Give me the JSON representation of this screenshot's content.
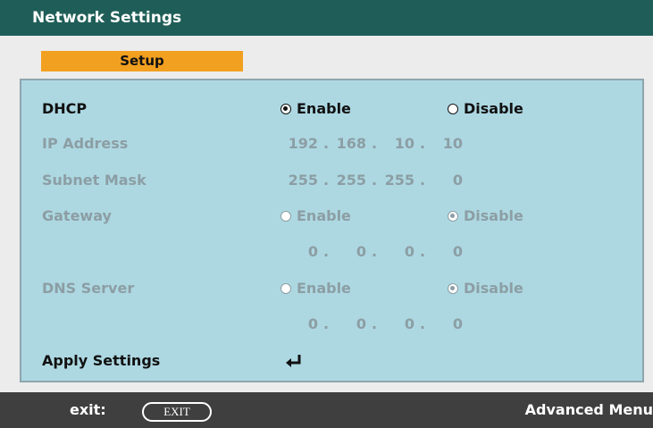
{
  "window": {
    "title": "Network Settings"
  },
  "tab": {
    "label": "Setup"
  },
  "rows": {
    "dhcp": {
      "label": "DHCP",
      "enable": "Enable",
      "disable": "Disable",
      "selected": "Enable"
    },
    "ip": {
      "label": "IP Address",
      "o1": "192",
      "o2": "168",
      "o3": "10",
      "o4": "10"
    },
    "subnet": {
      "label": "Subnet Mask",
      "o1": "255",
      "o2": "255",
      "o3": "255",
      "o4": "0"
    },
    "gateway": {
      "label": "Gateway",
      "enable": "Enable",
      "disable": "Disable",
      "selected": "Disable"
    },
    "gateway_ip": {
      "o1": "0",
      "o2": "0",
      "o3": "0",
      "o4": "0"
    },
    "dns": {
      "label": "DNS Server",
      "enable": "Enable",
      "disable": "Disable",
      "selected": "Disable"
    },
    "dns_ip": {
      "o1": "0",
      "o2": "0",
      "o3": "0",
      "o4": "0"
    },
    "apply": {
      "label": "Apply Settings",
      "icon": "enter-icon"
    }
  },
  "footer": {
    "exit_label": "exit:",
    "exit_button": "EXIT",
    "advanced": "Advanced Menu"
  },
  "colors": {
    "title_bar": "#1f5e58",
    "tab": "#f2a020",
    "panel": "#add8e2",
    "footer": "#3f3f3f",
    "disabled_text": "#8c9ea4"
  }
}
